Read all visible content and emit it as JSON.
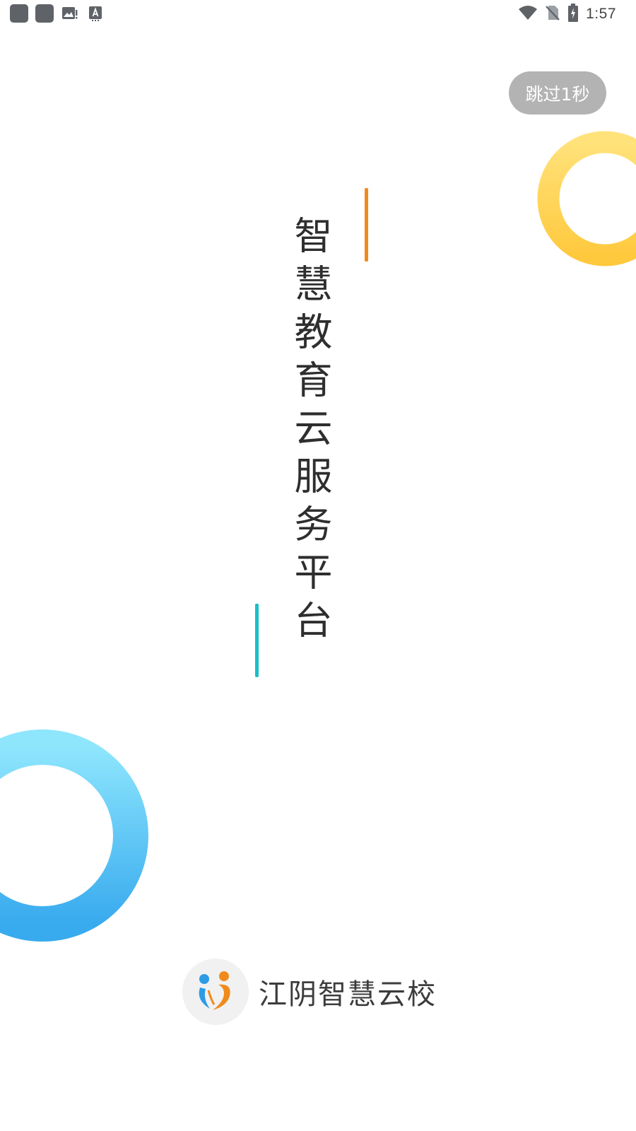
{
  "status_bar": {
    "time": "1:57",
    "left_icons": [
      "app-notification-icon",
      "app-notification-icon",
      "image-alert-icon",
      "font-download-icon"
    ],
    "right_icons": [
      "wifi-icon",
      "no-sim-icon",
      "battery-charging-icon"
    ]
  },
  "skip_button": {
    "label": "跳过1秒"
  },
  "slogan": {
    "text": "智慧教育云服务平台"
  },
  "brand": {
    "app_name": "江阴智慧云校"
  },
  "colors": {
    "ring_yellow": "#FFD54F",
    "ring_blue": "#4FC3F7",
    "accent_orange": "#F08A1C",
    "accent_cyan": "#19BFC8",
    "skip_bg": "#B3B3B3"
  }
}
